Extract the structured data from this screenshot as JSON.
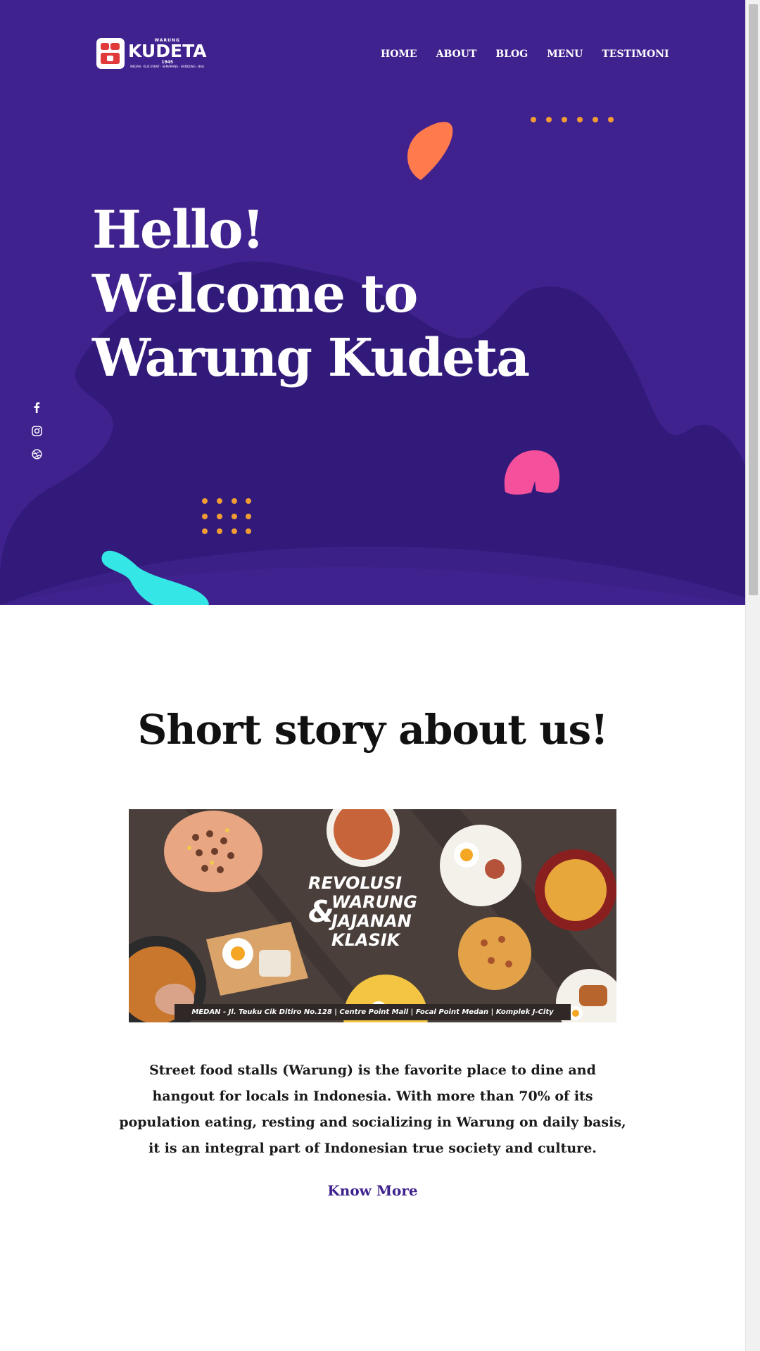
{
  "logo": {
    "top_text": "WARUNG",
    "brand": "KUDETA",
    "year": "1945",
    "cities": "MEDAN · KLIK EVENT · SEMARANG · BANDUNG · BALI"
  },
  "nav": {
    "items": [
      "HOME",
      "ABOUT",
      "BLOG",
      "MENU",
      "TESTIMONI"
    ]
  },
  "hero": {
    "line1": "Hello!",
    "line2": "Welcome to",
    "line3": "Warung Kudeta"
  },
  "social": {
    "icons": [
      "facebook-icon",
      "instagram-icon",
      "dribbble-icon"
    ]
  },
  "about": {
    "title": "Short story about us!",
    "banner": {
      "line1": "REVOLUSI",
      "line2": "WARUNG",
      "amp": "&",
      "line3": "JAJANAN",
      "line4": "KLASIK",
      "footer": "MEDAN - Jl. Teuku Cik Ditiro No.128 | Centre Point Mall | Focal Point Medan | Komplek J-City"
    },
    "body": "Street food stalls (Warung) is the favorite place to dine and hangout for locals in Indonesia. With more than 70% of its population eating, resting and socializing in Warung on daily basis, it is an integral part of Indonesian true society and culture.",
    "cta": "Know More"
  },
  "colors": {
    "hero_bg": "#40228f",
    "hero_shape": "#321a7a",
    "accent_orange": "#f39c33",
    "leaf_coral": "#ff7a4d",
    "blob_pink": "#f5509c",
    "blob_cyan": "#35e6e6",
    "link": "#40228f"
  }
}
